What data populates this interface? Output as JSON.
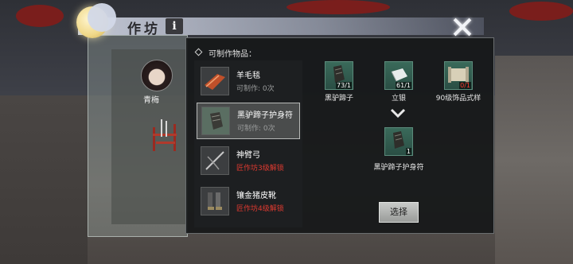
{
  "window": {
    "title": "作坊",
    "info_label": "i"
  },
  "npc": {
    "name": "青梅"
  },
  "craft_panel": {
    "header": "可制作物品：",
    "items": [
      {
        "name": "羊毛毯",
        "status": "可制作: 0次",
        "locked": false,
        "icon": "rug-icon"
      },
      {
        "name": "黑驴蹄子护身符",
        "status": "可制作: 0次",
        "locked": false,
        "selected": true,
        "icon": "hoof-amulet-icon"
      },
      {
        "name": "神臂弓",
        "status": "匠作坊3级解锁",
        "locked": true,
        "icon": "crossbow-icon"
      },
      {
        "name": "镶金猪皮靴",
        "status": "匠作坊4级解锁",
        "locked": true,
        "icon": "boots-icon"
      }
    ]
  },
  "recipe": {
    "materials": [
      {
        "name": "黑驴蹄子",
        "count": "73/1",
        "enough": true,
        "icon": "hoof-icon"
      },
      {
        "name": "立银",
        "count": "61/1",
        "enough": true,
        "icon": "silver-icon"
      },
      {
        "name": "90级饰品式样",
        "count": "0/1",
        "enough": false,
        "icon": "scroll-icon"
      }
    ],
    "result": {
      "name": "黑驴蹄子护身符",
      "count": "1",
      "icon": "hoof-amulet-icon"
    },
    "select_label": "选择"
  },
  "colors": {
    "locked_text": "#e03a30",
    "panel_bg": "#16181a",
    "selected_bg": "#4a4c4c"
  }
}
